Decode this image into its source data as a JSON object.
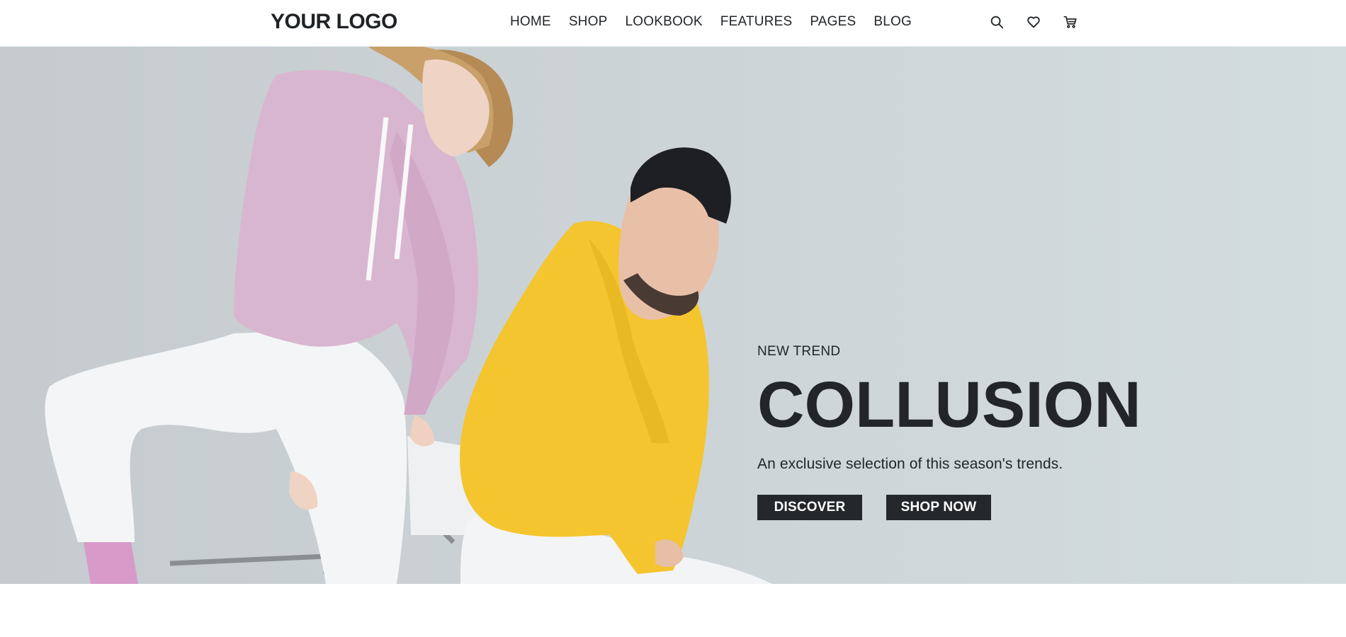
{
  "header": {
    "logo": "YOUR LOGO",
    "nav": [
      {
        "label": "HOME"
      },
      {
        "label": "SHOP"
      },
      {
        "label": "LOOKBOOK"
      },
      {
        "label": "FEATURES"
      },
      {
        "label": "PAGES"
      },
      {
        "label": "BLOG"
      }
    ],
    "icons": [
      "search-icon",
      "heart-icon",
      "cart-icon"
    ]
  },
  "hero": {
    "eyebrow": "NEW TREND",
    "title": "COLLUSION",
    "description": "An exclusive selection of this season's trends.",
    "buttons": {
      "discover": "DISCOVER",
      "shop_now": "SHOP NOW"
    }
  },
  "colors": {
    "text": "#222629",
    "button_bg": "#24282b",
    "button_text": "#ffffff",
    "hero_bg": "#cfd5d8",
    "hoodie_pink": "#d9b5d0",
    "hoodie_yellow": "#f3c632"
  }
}
